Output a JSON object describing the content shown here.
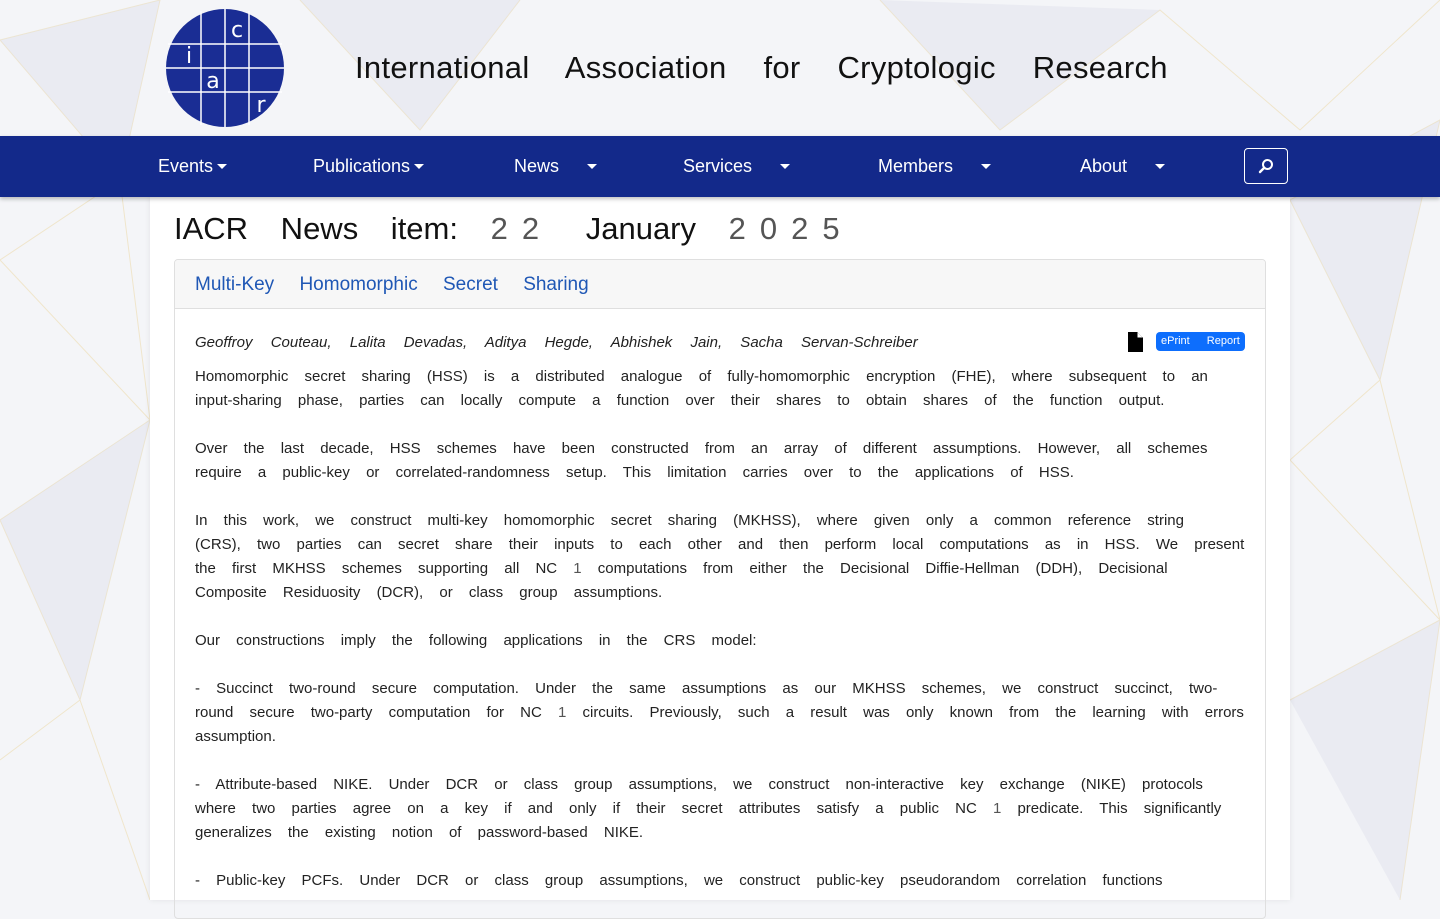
{
  "site": {
    "title": "International Association for Cryptologic Research",
    "logo_letters": [
      "i",
      "a",
      "c",
      "r"
    ]
  },
  "nav": {
    "items": [
      {
        "label": "Events",
        "dropdown": true
      },
      {
        "label": "Publications",
        "dropdown": true
      },
      {
        "label": "News",
        "dropdown": true
      },
      {
        "label": "Services",
        "dropdown": true
      },
      {
        "label": "Members",
        "dropdown": true
      },
      {
        "label": "About",
        "dropdown": true
      }
    ],
    "search_icon": "search-icon"
  },
  "page": {
    "title_prefix": "IACR News item:",
    "day": "22",
    "month": "January",
    "year": "2025"
  },
  "item": {
    "title": "Multi-Key Homomorphic Secret Sharing",
    "authors": "Geoffroy Couteau, Lalita Devadas, Aditya Hegde, Abhishek Jain, Sacha Servan-Schreiber",
    "document_icon": "file-icon",
    "badge": "ePrint Report",
    "abstract": {
      "p1": "Homomorphic secret sharing (HSS) is a distributed analogue of fully-homomorphic encryption (FHE), where subsequent to an input-sharing phase, parties can locally compute a function over their shares to obtain shares of the function output.",
      "p2": "Over the last decade, HSS schemes have been constructed from an array of different assumptions. However, all schemes require a public-key or correlated-randomness setup. This limitation carries over to the applications of HSS.",
      "p3_a": "In this work, we construct multi-key homomorphic secret sharing (MKHSS), where given only a common reference string (CRS), two parties can secret share their inputs to each other and then perform local computations as in HSS. We present the first MKHSS schemes supporting all NC",
      "p3_b": "computations from either the Decisional Diffie-Hellman (DDH), Decisional Composite Residuosity (DCR), or class group assumptions.",
      "p4": "Our constructions imply the following applications in the CRS model:",
      "p5_a": "- Succinct two-round secure computation. Under the same assumptions as our MKHSS schemes, we construct succinct, two-round secure two-party computation for NC",
      "p5_b": "circuits. Previously, such a result was only known from the learning with errors assumption.",
      "p6_a": "- Attribute-based NIKE. Under DCR or class group assumptions, we construct non-interactive key exchange (NIKE) protocols where two parties agree on a key if and only if their secret attributes satisfy a public NC",
      "p6_b": "predicate. This significantly generalizes the existing notion of password-based NIKE.",
      "p7": "- Public-key PCFs. Under DCR or class group assumptions, we construct public-key pseudorandom correlation functions",
      "nc_superscript": "1"
    }
  },
  "colors": {
    "navbar": "#13298a",
    "logo": "#1a2d94",
    "link": "#1f57b5",
    "badge": "#0d6efd"
  }
}
